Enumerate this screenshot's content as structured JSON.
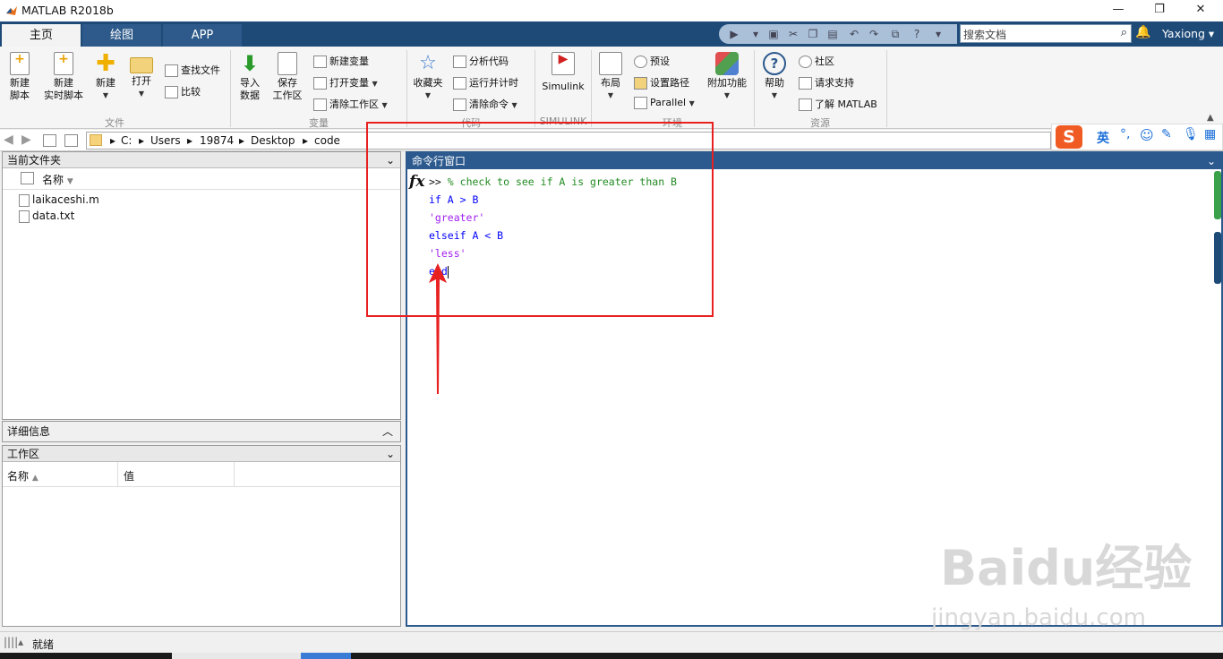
{
  "app": {
    "title": "MATLAB R2018b"
  },
  "window": {
    "minimize": "—",
    "restore": "❐",
    "close": "✕"
  },
  "tabs": [
    "主页",
    "绘图",
    "APP"
  ],
  "search": {
    "placeholder": "搜索文档"
  },
  "user": {
    "name": "Yaxiong"
  },
  "ribbon": {
    "new_script": "新建\n脚本",
    "new_script_l1": "新建",
    "new_script_l2": "脚本",
    "new_live_l1": "新建",
    "new_live_l2": "实时脚本",
    "new": "新建",
    "open": "打开",
    "find_files": "查找文件",
    "compare": "比较",
    "import_l1": "导入",
    "import_l2": "数据",
    "save_ws_l1": "保存",
    "save_ws_l2": "工作区",
    "new_variable": "新建变量",
    "open_variable": "打开变量",
    "clear_workspace": "清除工作区",
    "favorites": "收藏夹",
    "analyze_code": "分析代码",
    "run_time": "运行并计时",
    "clear_commands": "清除命令",
    "simulink": "Simulink",
    "layout": "布局",
    "preferences": "预设",
    "set_path": "设置路径",
    "parallel": "Parallel",
    "addons": "附加功能",
    "help": "帮助",
    "community": "社区",
    "request_support": "请求支持",
    "learn_matlab": "了解 MATLAB",
    "groups": {
      "file": "文件",
      "variable": "变量",
      "code": "代码",
      "simulink": "SIMULINK",
      "environment": "环境",
      "resources": "资源"
    }
  },
  "address": {
    "parts": [
      "C:",
      "Users",
      "19874",
      "Desktop",
      "code"
    ]
  },
  "current_folder": {
    "title": "当前文件夹",
    "col_name": "名称",
    "files": [
      "laikaceshi.m",
      "data.txt"
    ]
  },
  "details": {
    "title": "详细信息"
  },
  "workspace": {
    "title": "工作区",
    "col_name": "名称",
    "col_value": "值"
  },
  "command_window": {
    "title": "命令行窗口",
    "prompt": ">>",
    "comment": "% check to see if A is greater than B",
    "lines": [
      "if A > B",
      "'greater'",
      "elseif A < B",
      "'less'",
      "end"
    ],
    "fx": "fx"
  },
  "status": {
    "text": "就绪"
  },
  "ime": {
    "lang": "英"
  },
  "watermark": {
    "brand": "Baidu经验",
    "url": "jingyan.baidu.com"
  },
  "colors": {
    "accent": "#2c5a8e",
    "tabbar": "#1e4a78",
    "annotation": "#e82020"
  }
}
